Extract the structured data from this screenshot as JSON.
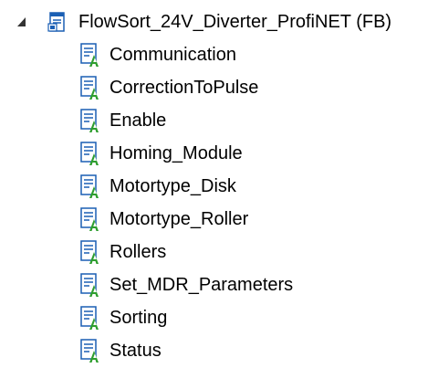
{
  "tree": {
    "root": {
      "label": "FlowSort_24V_Diverter_ProfiNET (FB)",
      "expanded": true,
      "icon": "function-block-icon"
    },
    "children": [
      {
        "label": "Communication",
        "icon": "network-icon"
      },
      {
        "label": "CorrectionToPulse",
        "icon": "network-icon"
      },
      {
        "label": "Enable",
        "icon": "network-icon"
      },
      {
        "label": "Homing_Module",
        "icon": "network-icon"
      },
      {
        "label": "Motortype_Disk",
        "icon": "network-icon"
      },
      {
        "label": "Motortype_Roller",
        "icon": "network-icon"
      },
      {
        "label": "Rollers",
        "icon": "network-icon"
      },
      {
        "label": "Set_MDR_Parameters",
        "icon": "network-icon"
      },
      {
        "label": "Sorting",
        "icon": "network-icon"
      },
      {
        "label": "Status",
        "icon": "network-icon"
      }
    ]
  },
  "colors": {
    "icon_blue": "#1a5fb4",
    "icon_green": "#2e9e2e",
    "expander": "#333333"
  }
}
